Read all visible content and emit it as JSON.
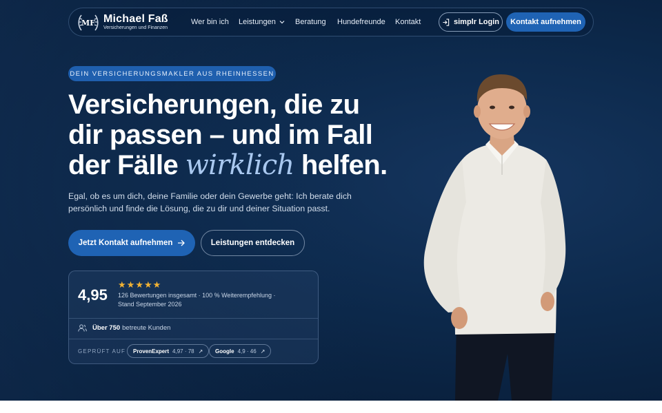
{
  "nav": {
    "logo_initials": "MF",
    "logo_name": "Michael Faß",
    "logo_subtitle": "Versicherungen und Finanzen",
    "links": [
      {
        "label": "Wer bin ich"
      },
      {
        "label": "Leistungen",
        "has_dropdown": true
      },
      {
        "label": "Beratung"
      },
      {
        "label": "Hundefreunde"
      },
      {
        "label": "Kontakt"
      }
    ],
    "login_label": "simplr Login",
    "contact_label": "Kontakt aufnehmen"
  },
  "hero": {
    "eyebrow": "DEIN VERSICHERUNGSMAKLER AUS RHEINHESSEN",
    "headline_line1": "Versicherungen, die zu",
    "headline_line2": "dir passen – und im Fall",
    "headline_line3_start": "der Fälle ",
    "headline_accent": "wirklich",
    "headline_line3_end": " helfen.",
    "subtext": "Egal, ob es um dich, deine Familie oder dein Gewerbe geht: Ich berate dich persönlich und finde die Lösung, die zu dir und deiner Situation passt.",
    "primary_cta": "Jetzt Kontakt aufnehmen",
    "secondary_cta": "Leistungen entdecken"
  },
  "rating": {
    "score": "4,95",
    "stars": 5,
    "text": "126 Bewertungen insgesamt · 100 % Weiterempfehlung · Stand September 2026",
    "customers_bold": "Über 750",
    "customers_rest": "betreute Kunden",
    "verified_label": "GEPRÜFT AUF",
    "badges": [
      {
        "name": "ProvenExpert",
        "detail": "4,97 · 78"
      },
      {
        "name": "Google",
        "detail": "4,9 · 46"
      }
    ]
  },
  "colors": {
    "accent": "#1f63b4",
    "background": "#0b2547",
    "star": "#f2b233",
    "headline_accent": "#a9c8ef"
  }
}
